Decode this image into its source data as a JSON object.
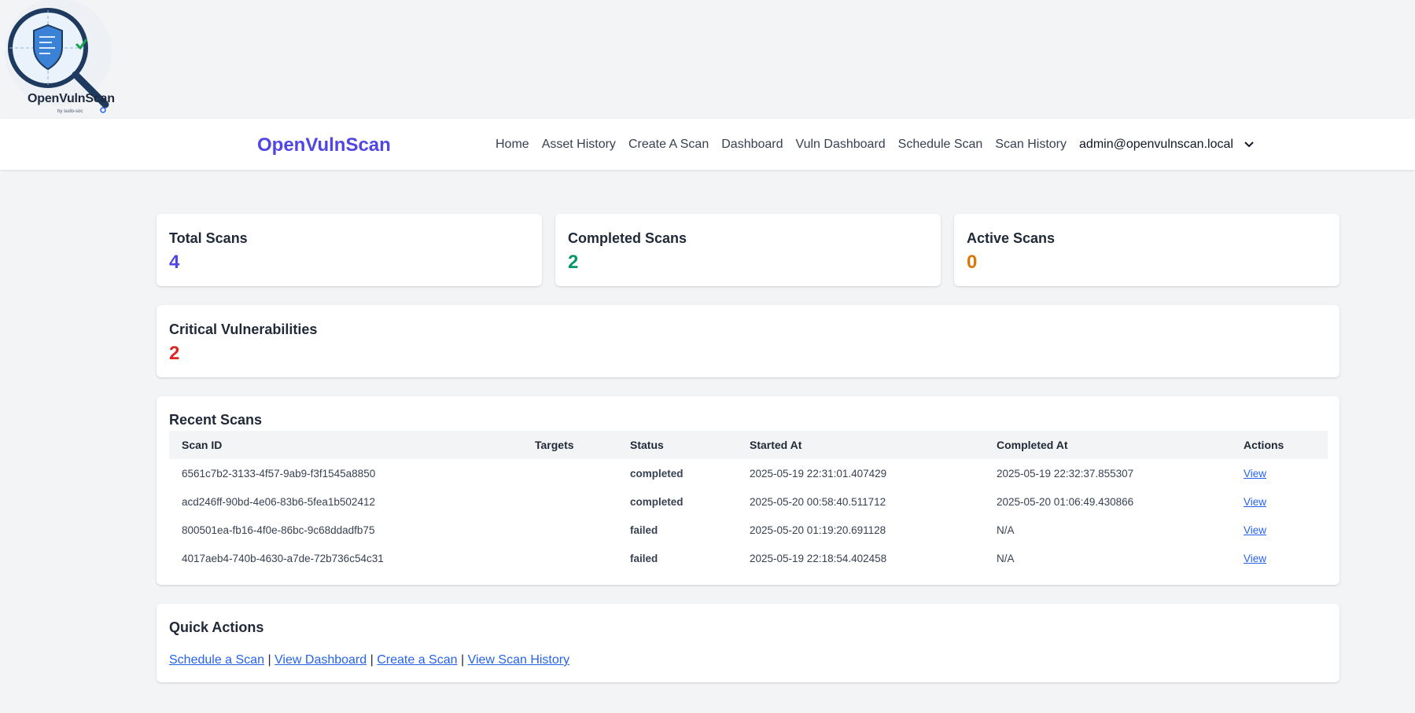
{
  "logo": {
    "name": "OpenVulnScan",
    "byline": "by sudo-soc"
  },
  "navbar": {
    "brand": "OpenVulnScan",
    "links": [
      "Home",
      "Asset History",
      "Create A Scan",
      "Dashboard",
      "Vuln Dashboard",
      "Schedule Scan",
      "Scan History"
    ],
    "user_email": "admin@openvulnscan.local"
  },
  "stats": {
    "total": {
      "label": "Total Scans",
      "value": "4",
      "color": "#4f46e5"
    },
    "completed": {
      "label": "Completed Scans",
      "value": "2",
      "color": "#059669"
    },
    "active": {
      "label": "Active Scans",
      "value": "0",
      "color": "#d97706"
    },
    "critical": {
      "label": "Critical Vulnerabilities",
      "value": "2",
      "color": "#dc2626"
    }
  },
  "recent_scans": {
    "title": "Recent Scans",
    "columns": [
      "Scan ID",
      "Targets",
      "Status",
      "Started At",
      "Completed At",
      "Actions"
    ],
    "rows": [
      {
        "id": "6561c7b2-3133-4f57-9ab9-f3f1545a8850",
        "targets": "",
        "status": "completed",
        "started": "2025-05-19 22:31:01.407429",
        "completed": "2025-05-19 22:32:37.855307",
        "action": "View"
      },
      {
        "id": "acd246ff-90bd-4e06-83b6-5fea1b502412",
        "targets": "",
        "status": "completed",
        "started": "2025-05-20 00:58:40.511712",
        "completed": "2025-05-20 01:06:49.430866",
        "action": "View"
      },
      {
        "id": "800501ea-fb16-4f0e-86bc-9c68ddadfb75",
        "targets": "",
        "status": "failed",
        "started": "2025-05-20 01:19:20.691128",
        "completed": "N/A",
        "action": "View"
      },
      {
        "id": "4017aeb4-740b-4630-a7de-72b736c54c31",
        "targets": "",
        "status": "failed",
        "started": "2025-05-19 22:18:54.402458",
        "completed": "N/A",
        "action": "View"
      }
    ]
  },
  "quick_actions": {
    "title": "Quick Actions",
    "links": [
      "Schedule a Scan",
      "View Dashboard",
      "Create a Scan",
      "View Scan History"
    ],
    "separator": "|"
  }
}
